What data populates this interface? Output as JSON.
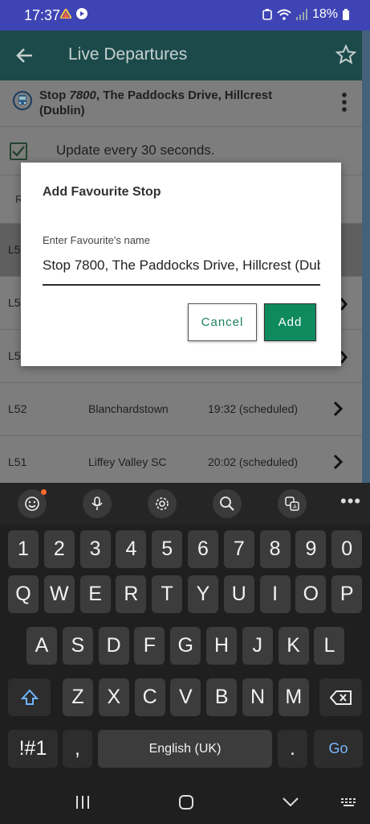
{
  "status_bar": {
    "time": "17:37",
    "battery": "18%"
  },
  "app_bar": {
    "title": "Live Departures"
  },
  "stop": {
    "prefix": "Stop ",
    "number": "7800",
    "name": ", The Paddocks Drive, Hillcrest (Dublin)"
  },
  "update": {
    "label": "Update every 30 seconds.",
    "checked": true
  },
  "table_header_partial": "R",
  "departures": [
    {
      "route": "L5",
      "destination": "",
      "time": "",
      "selected": true
    },
    {
      "route": "L5",
      "destination": "",
      "time": ""
    },
    {
      "route": "L5",
      "destination": "",
      "time": ""
    },
    {
      "route": "L52",
      "destination": "Blanchardstown",
      "time": "19:32 (scheduled)"
    },
    {
      "route": "L51",
      "destination": "Liffey Valley SC",
      "time": "20:02 (scheduled)"
    }
  ],
  "dialog": {
    "title": "Add Favourite Stop",
    "field_label": "Enter Favourite's name",
    "field_value": "Stop 7800, The Paddocks Drive, Hillcrest (Dub",
    "cancel_label": "Cancel",
    "add_label": "Add"
  },
  "keyboard": {
    "toolbar": [
      "emoji-icon",
      "mic-icon",
      "settings-icon",
      "search-icon",
      "translate-icon",
      "more-icon"
    ],
    "rows": [
      [
        "1",
        "2",
        "3",
        "4",
        "5",
        "6",
        "7",
        "8",
        "9",
        "0"
      ],
      [
        "Q",
        "W",
        "E",
        "R",
        "T",
        "Y",
        "U",
        "I",
        "O",
        "P"
      ],
      [
        "A",
        "S",
        "D",
        "F",
        "G",
        "H",
        "J",
        "K",
        "L"
      ],
      [
        "Z",
        "X",
        "C",
        "V",
        "B",
        "N",
        "M"
      ]
    ],
    "symbols_label": "!#1",
    "comma_label": ",",
    "space_label": "English (UK)",
    "period_label": ".",
    "go_label": "Go"
  },
  "colors": {
    "app_bar": "#1c4a4a",
    "accent_green": "#0f8a5f",
    "status_bar": "#3f44b5"
  }
}
